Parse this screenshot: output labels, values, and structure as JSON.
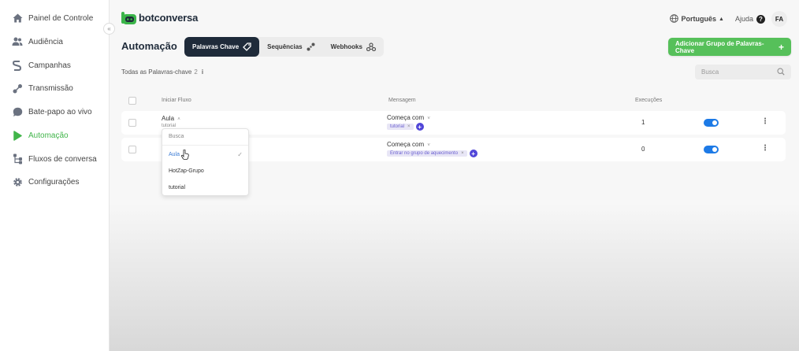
{
  "sidebar": {
    "items": [
      {
        "label": "Painel de Controle",
        "icon": "home-icon"
      },
      {
        "label": "Audiência",
        "icon": "users-icon"
      },
      {
        "label": "Campanhas",
        "icon": "campaign-icon"
      },
      {
        "label": "Transmissão",
        "icon": "broadcast-icon"
      },
      {
        "label": "Bate-papo ao vivo",
        "icon": "chat-icon"
      },
      {
        "label": "Automação",
        "icon": "play-icon"
      },
      {
        "label": "Fluxos de conversa",
        "icon": "flow-icon"
      },
      {
        "label": "Configurações",
        "icon": "gear-icon"
      }
    ],
    "active_index": 5,
    "collapse_glyph": "«"
  },
  "header": {
    "brand": "botconversa",
    "language": "Português",
    "help_label": "Ajuda",
    "help_glyph": "?",
    "avatar_initials": "FA"
  },
  "page": {
    "title": "Automação",
    "tabs": [
      {
        "label": "Palavras Chave",
        "icon": "tag-icon"
      },
      {
        "label": "Sequências",
        "icon": "sequence-icon"
      },
      {
        "label": "Webhooks",
        "icon": "webhook-icon"
      }
    ],
    "add_button_label": "Adicionar Grupo de Palavras-Chave",
    "add_button_plus": "+",
    "subtitle": "Todas as Palavras-chave",
    "subtitle_count": "2",
    "info_glyph": "i",
    "search_placeholder": "Busca"
  },
  "table": {
    "headers": {
      "flow": "Iniciar Fluxo",
      "message": "Mensagem",
      "executions": "Execuções"
    },
    "rows": [
      {
        "flow": "Aula",
        "flow_sub": "tutorial",
        "condition": "Começa com",
        "tag": "tutorial",
        "executions": "1",
        "enabled": true
      },
      {
        "flow": "",
        "flow_sub": "",
        "condition": "Começa com",
        "tag": "Entrar no grupo de aquecimento",
        "executions": "0",
        "enabled": true
      }
    ]
  },
  "dropdown": {
    "search_placeholder": "Busca",
    "options": [
      "Aula",
      "HotZap-Grupo",
      "tutorial"
    ],
    "selected_index": 0
  },
  "colors": {
    "brand_green": "#56c05a",
    "active_green": "#41b54a",
    "dark_navy": "#1f2b3a",
    "toggle_blue": "#1d7ae6",
    "tag_purple": "#6a5fd0"
  }
}
